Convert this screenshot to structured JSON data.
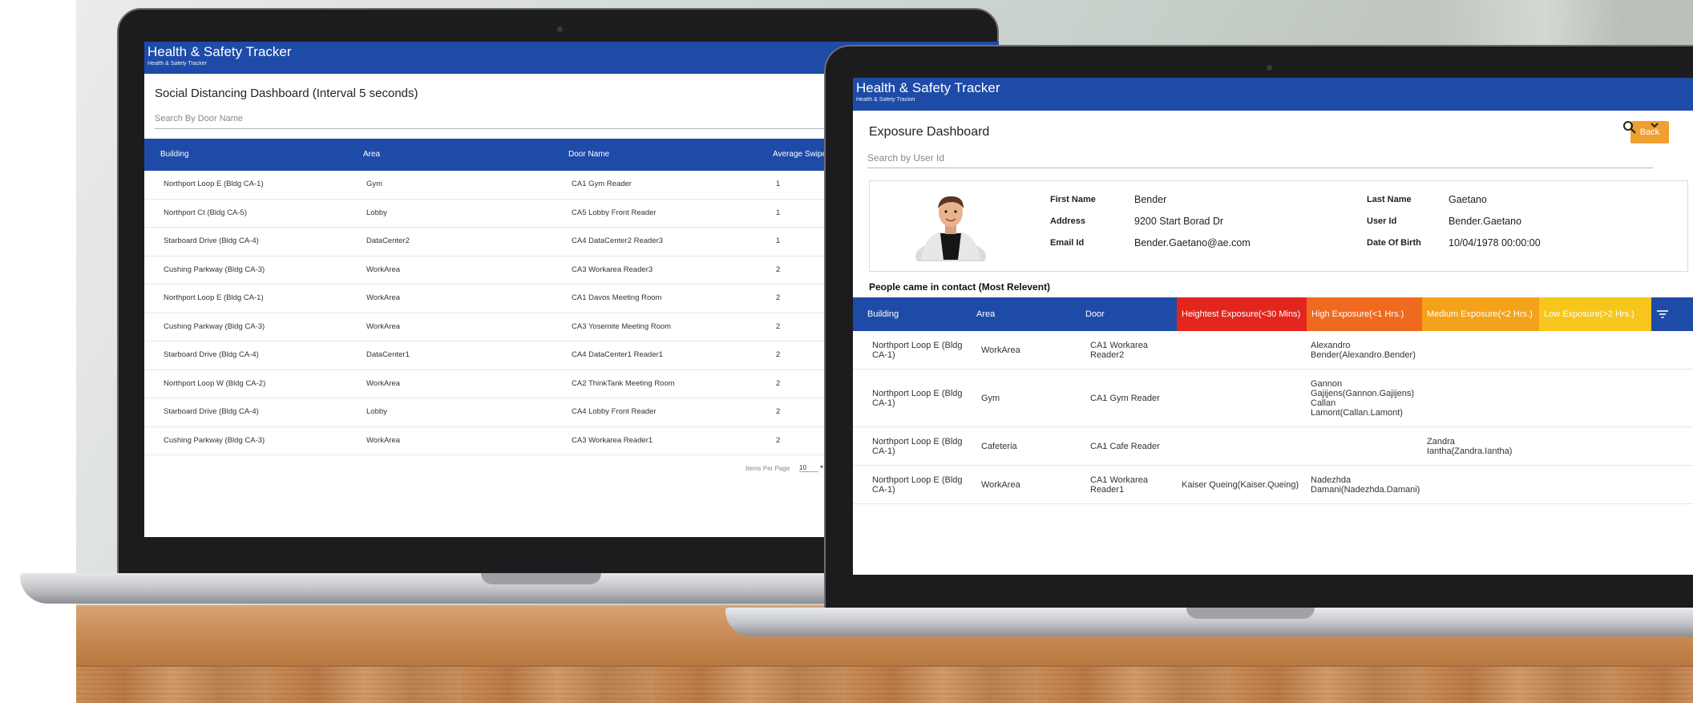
{
  "dashboard1": {
    "app_title": "Health & Safety Tracker",
    "app_subtitle": "Health & Safety Tracker",
    "page_title": "Social Distancing Dashboard (Interval 5 seconds)",
    "search_placeholder": "Search By Door Name",
    "columns": [
      "Building",
      "Area",
      "Door Name",
      "Average Swipe"
    ],
    "rows": [
      [
        "Northport Loop E (Bldg CA-1)",
        "Gym",
        "CA1 Gym Reader",
        "1"
      ],
      [
        "Northport Ct (Bldg CA-5)",
        "Lobby",
        "CA5 Lobby Front Reader",
        "1"
      ],
      [
        "Starboard Drive (Bldg CA-4)",
        "DataCenter2",
        "CA4 DataCenter2 Reader3",
        "1"
      ],
      [
        "Cushing Parkway (Bldg CA-3)",
        "WorkArea",
        "CA3 Workarea Reader3",
        "2"
      ],
      [
        "Northport Loop E (Bldg CA-1)",
        "WorkArea",
        "CA1 Davos Meeting Room",
        "2"
      ],
      [
        "Cushing Parkway (Bldg CA-3)",
        "WorkArea",
        "CA3 Yosemite Meeting Room",
        "2"
      ],
      [
        "Starboard Drive (Bldg CA-4)",
        "DataCenter1",
        "CA4 DataCenter1 Reader1",
        "2"
      ],
      [
        "Northport Loop W (Bldg CA-2)",
        "WorkArea",
        "CA2 ThinkTank Meeting Room",
        "2"
      ],
      [
        "Starboard Drive (Bldg CA-4)",
        "Lobby",
        "CA4 Lobby Front Reader",
        "2"
      ],
      [
        "Cushing Parkway (Bldg CA-3)",
        "WorkArea",
        "CA3 Workarea Reader1",
        "2"
      ]
    ],
    "pager_label": "Items Per Page",
    "pager_value": "10",
    "pager_dropdown": "▾"
  },
  "dashboard2": {
    "app_title": "Health & Safety Tracker",
    "app_subtitle": "Health & Safety Tracker",
    "page_title": "Exposure Dashboard",
    "back_label": "Back",
    "search_placeholder": "Search by User Id",
    "chevron": "⌄",
    "profile": {
      "first_name_label": "First Name",
      "first_name": "Bender",
      "address_label": "Address",
      "address": "9200 Start Borad Dr",
      "email_label": "Email Id",
      "email": "Bender.Gaetano@ae.com",
      "last_name_label": "Last Name",
      "last_name": "Gaetano",
      "user_id_label": "User Id",
      "user_id": "Bender.Gaetano",
      "dob_label": "Date Of Birth",
      "dob": "10/04/1978 00:00:00"
    },
    "contact_title": "People came in contact (Most Relevent)",
    "columns": {
      "building": "Building",
      "area": "Area",
      "door": "Door",
      "highest": "Heightest Exposure(<30 Mins)",
      "high": "High Exposure(<1 Hrs.)",
      "medium": "Medium Exposure(<2 Hrs.)",
      "low": "Low Exposure(>2 Hrs.)"
    },
    "colors": {
      "header_blue": "#1e4ba8",
      "highest": "#e2261d",
      "high": "#ef6a1f",
      "medium": "#f4a21a",
      "low": "#f6c61c",
      "back_button": "#f0a030"
    },
    "rows": [
      {
        "building": "Northport Loop E (Bldg CA-1)",
        "area": "WorkArea",
        "door": "CA1 Workarea Reader2",
        "highest": "",
        "high": "Alexandro Bender(Alexandro.Bender)",
        "medium": "",
        "low": ""
      },
      {
        "building": "Northport Loop E (Bldg CA-1)",
        "area": "Gym",
        "door": "CA1 Gym Reader",
        "highest": "",
        "high": "Gannon Gajijens(Gannon.Gajijens) Callan Lamont(Callan.Lamont)",
        "medium": "",
        "low": ""
      },
      {
        "building": "Northport Loop E (Bldg CA-1)",
        "area": "Cafeteria",
        "door": "CA1 Cafe Reader",
        "highest": "",
        "high": "",
        "medium": "Zandra Iantha(Zandra.Iantha)",
        "low": ""
      },
      {
        "building": "Northport Loop E (Bldg CA-1)",
        "area": "WorkArea",
        "door": "CA1 Workarea Reader1",
        "highest": "Kaiser Queing(Kaiser.Queing)",
        "high": "Nadezhda Damani(Nadezhda.Damani)",
        "medium": "",
        "low": ""
      }
    ]
  }
}
